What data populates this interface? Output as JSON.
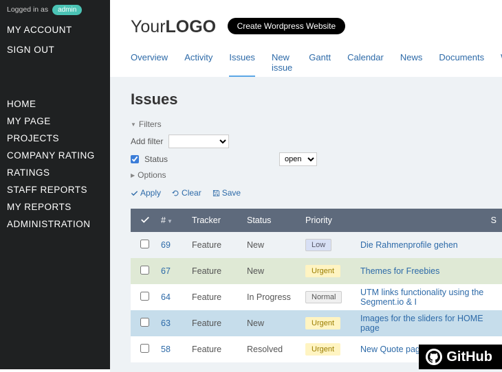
{
  "sidebar": {
    "login_prefix": "Logged in as",
    "login_user": "admin",
    "account": "MY ACCOUNT",
    "signout": "SIGN OUT",
    "nav": [
      "HOME",
      "MY PAGE",
      "PROJECTS",
      "COMPANY RATING",
      "RATINGS",
      "STAFF REPORTS",
      "MY REPORTS",
      "ADMINISTRATION"
    ]
  },
  "header": {
    "logo_a": "Your",
    "logo_b": "LOGO",
    "cta": "Create Wordpress Website"
  },
  "tabs": [
    "Overview",
    "Activity",
    "Issues",
    "New issue",
    "Gantt",
    "Calendar",
    "News",
    "Documents",
    "W"
  ],
  "active_tab": "Issues",
  "page_title": "Issues",
  "filters": {
    "label": "Filters",
    "add_filter": "Add filter",
    "status_label": "Status",
    "status_value": "open",
    "options_label": "Options"
  },
  "actions": {
    "apply": "Apply",
    "clear": "Clear",
    "save": "Save"
  },
  "columns": {
    "id": "#",
    "tracker": "Tracker",
    "status": "Status",
    "priority": "Priority",
    "subject": "S"
  },
  "rows": [
    {
      "id": "69",
      "tracker": "Feature",
      "status": "New",
      "priority": "Low",
      "pclass": "p-low",
      "subject": "Die Rahmenprofile gehen"
    },
    {
      "id": "67",
      "tracker": "Feature",
      "status": "New",
      "priority": "Urgent",
      "pclass": "p-urgent",
      "subject": "Themes for Freebies"
    },
    {
      "id": "64",
      "tracker": "Feature",
      "status": "In Progress",
      "priority": "Normal",
      "pclass": "p-normal",
      "subject": "UTM links functionality using the Segment.io & I"
    },
    {
      "id": "63",
      "tracker": "Feature",
      "status": "New",
      "priority": "Urgent",
      "pclass": "p-urgent",
      "subject": "Images for the sliders for HOME page"
    },
    {
      "id": "58",
      "tracker": "Feature",
      "status": "Resolved",
      "priority": "Urgent",
      "pclass": "p-urgent",
      "subject": "New Quote page La"
    }
  ],
  "github": "GitHub"
}
